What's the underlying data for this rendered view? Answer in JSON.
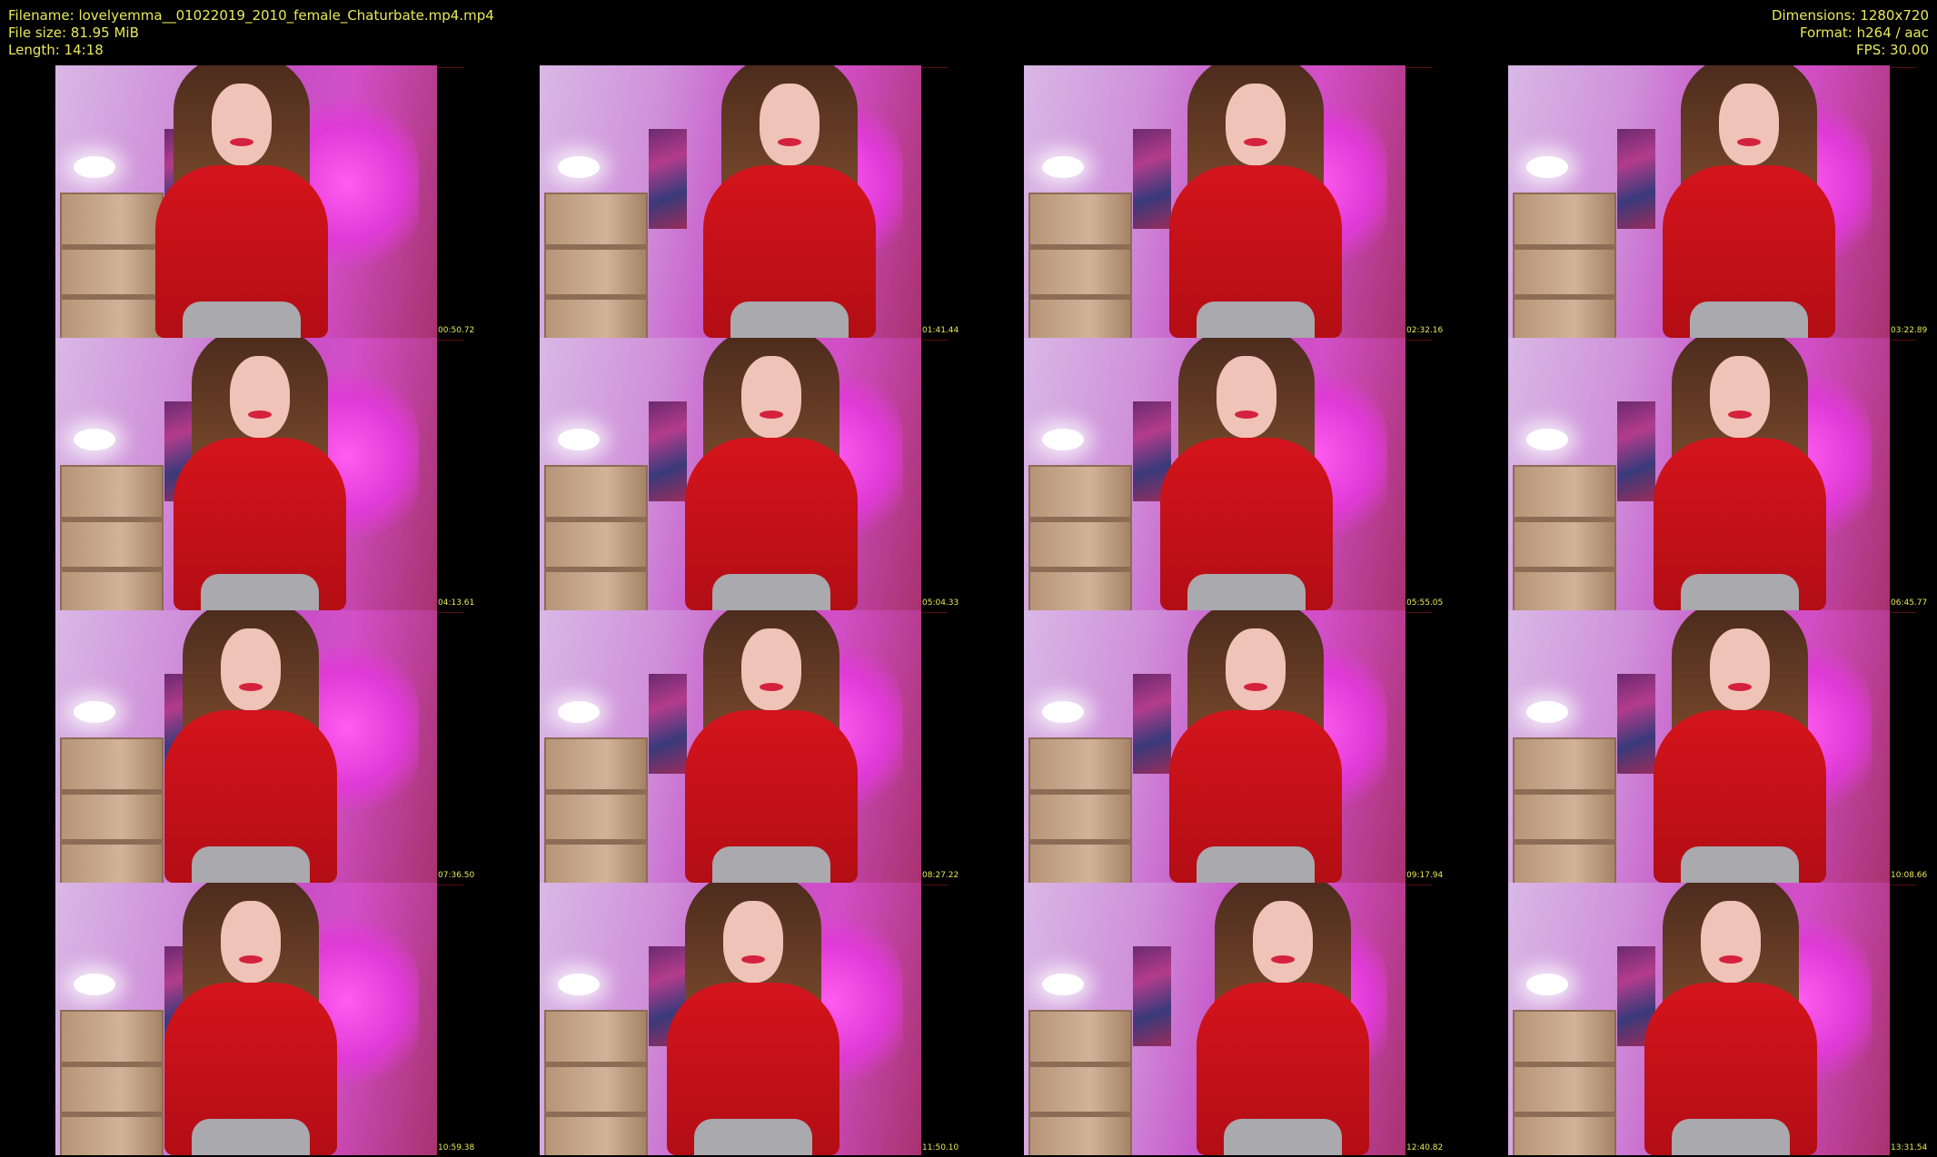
{
  "header": {
    "filename": "Filename: lovelyemma__01022019_2010_female_Chaturbate.mp4.mp4",
    "filesize": "File size: 81.95 MiB",
    "length": "Length: 14:18",
    "dimensions": "Dimensions: 1280x720",
    "format": "Format: h264 / aac",
    "fps": "FPS: 30.00"
  },
  "colors": {
    "background": "#000000",
    "text": "#e8e85a"
  },
  "thumbnails": [
    {
      "timestamp": "00:50.72"
    },
    {
      "timestamp": "01:41.44"
    },
    {
      "timestamp": "02:32.16"
    },
    {
      "timestamp": "03:22.89"
    },
    {
      "timestamp": "04:13.61"
    },
    {
      "timestamp": "05:04.33"
    },
    {
      "timestamp": "05:55.05"
    },
    {
      "timestamp": "06:45.77"
    },
    {
      "timestamp": "07:36.50"
    },
    {
      "timestamp": "08:27.22"
    },
    {
      "timestamp": "09:17.94"
    },
    {
      "timestamp": "10:08.66"
    },
    {
      "timestamp": "10:59.38"
    },
    {
      "timestamp": "11:50.10"
    },
    {
      "timestamp": "12:40.82"
    },
    {
      "timestamp": "13:31.54"
    }
  ]
}
